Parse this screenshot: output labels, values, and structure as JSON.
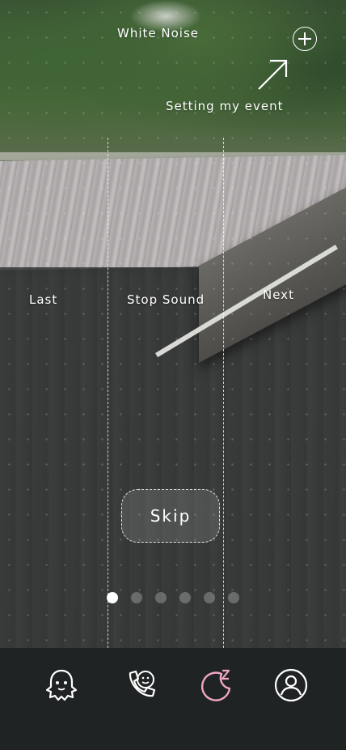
{
  "header": {
    "title": "White Noise",
    "setting_hint": "Setting my event",
    "add_icon": "plus-circle-icon",
    "arrow_icon": "arrow-up-right-icon"
  },
  "zones": {
    "left_label": "Last",
    "center_label": "Stop Sound",
    "right_label": "Next"
  },
  "skip_label": "Skip",
  "pagination": {
    "count": 6,
    "active_index": 0
  },
  "tabbar": {
    "items": [
      {
        "icon": "ghost-icon",
        "color": "#ffffff"
      },
      {
        "icon": "phone-face-icon",
        "color": "#ffffff"
      },
      {
        "icon": "moon-sleep-icon",
        "color": "#f0a6c6",
        "active": true
      },
      {
        "icon": "profile-icon",
        "color": "#ffffff"
      }
    ]
  },
  "colors": {
    "accent": "#f0a6c6",
    "tabbar_bg": "#1f2323"
  }
}
